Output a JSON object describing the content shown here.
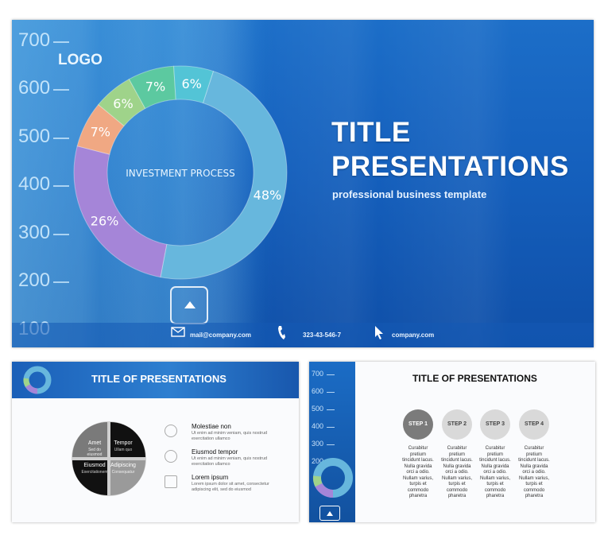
{
  "main": {
    "axis": [
      "700",
      "600",
      "500",
      "400",
      "300",
      "200",
      "100"
    ],
    "logo": "LOGO",
    "donut": {
      "center_label": "INVESTMENT PROCESS",
      "segments": [
        {
          "label": "48%",
          "value": 48,
          "color": "#67b7dd"
        },
        {
          "label": "26%",
          "value": 26,
          "color": "#a585d8"
        },
        {
          "label": "7%",
          "value": 7,
          "color": "#f0a883"
        },
        {
          "label": "6%",
          "value": 6,
          "color": "#9fd38a"
        },
        {
          "label": "7%",
          "value": 7,
          "color": "#5cc9a0"
        },
        {
          "label": "6%",
          "value": 6,
          "color": "#53c4d6"
        }
      ]
    },
    "title_line1": "TITLE",
    "title_line2": "PRESENTATIONS",
    "subtitle": "professional business template",
    "footer": {
      "email": "mail@company.com",
      "phone": "323-43-546-7",
      "web": "company.com"
    }
  },
  "slide2": {
    "title": "TITLE OF PRESENTATIONS",
    "cycle": [
      {
        "title": "Amet",
        "sub": "Sed do eiusmod"
      },
      {
        "title": "Tempor",
        "sub": "Ullam quo"
      },
      {
        "title": "Adipiscing",
        "sub": "Consequatur"
      },
      {
        "title": "Eiusmod",
        "sub": "Exercitationem"
      }
    ],
    "rows": [
      {
        "title": "Molestiae non",
        "text": "Ut enim ad minim veniam, quis nostrud exercitation ullamco"
      },
      {
        "title": "Eiusmod tempor",
        "text": "Ut enim ad minim veniam, quis nostrud exercitation ullamco"
      },
      {
        "title": "Lorem ipsum",
        "text": "Lorem ipsum dolor sit amet, consectetur adipiscing elit, sed do eiusmod"
      }
    ]
  },
  "slide3": {
    "title": "TITLE OF PRESENTATIONS",
    "axis": [
      "700",
      "600",
      "500",
      "400",
      "300",
      "200"
    ],
    "steps": [
      {
        "label": "STEP 1",
        "text": "Curabitur pretium tincidunt lacus. Nulla gravida orci a odio. Nullam varius, turpis et commodo pharetra"
      },
      {
        "label": "STEP 2",
        "text": "Curabitur pretium tincidunt lacus. Nulla gravida orci a odio. Nullam varius, turpis et commodo pharetra"
      },
      {
        "label": "STEP 3",
        "text": "Curabitur pretium tincidunt lacus. Nulla gravida orci a odio. Nullam varius, turpis et commodo pharetra"
      },
      {
        "label": "STEP 4",
        "text": "Curabitur pretium tincidunt lacus. Nulla gravida orci a odio. Nullam varius, turpis et commodo pharetra"
      }
    ]
  },
  "colors": {
    "accent": "#1560bd",
    "step_active": "#7b7b7b",
    "step_inactive": "#d9d9d9"
  }
}
